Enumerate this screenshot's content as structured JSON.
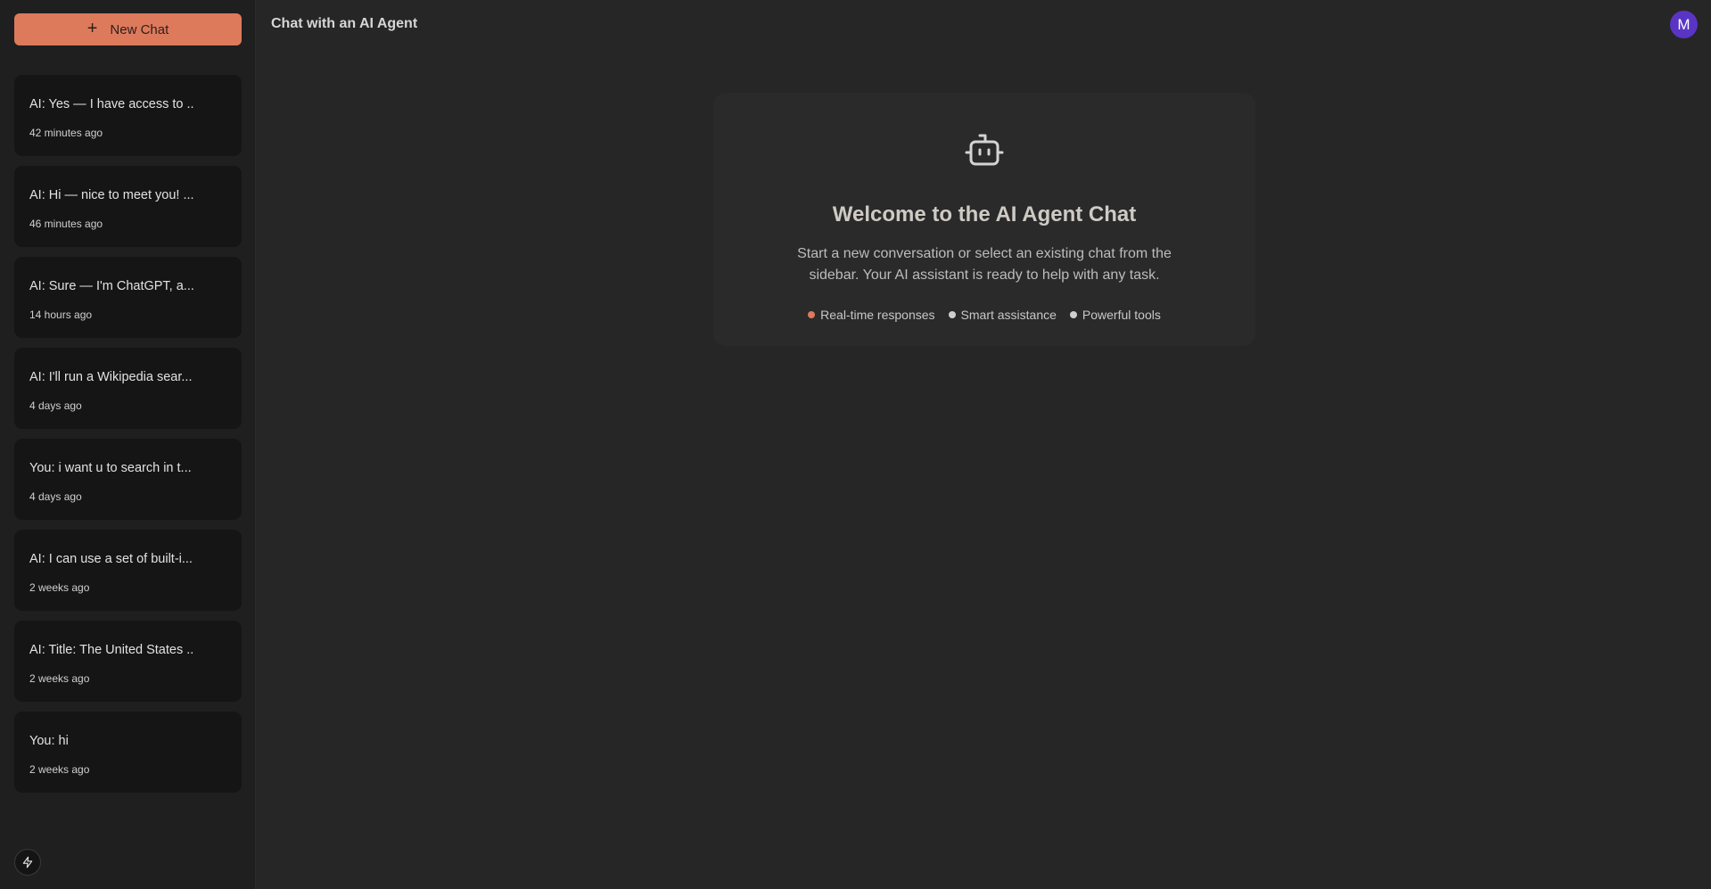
{
  "sidebar": {
    "new_chat_label": "New Chat",
    "chats": [
      {
        "title": "AI: Yes — I have access to ...",
        "time": "42 minutes ago"
      },
      {
        "title": "AI: Hi — nice to meet you! ...",
        "time": "46 minutes ago"
      },
      {
        "title": "AI: Sure — I'm ChatGPT, a...",
        "time": "14 hours ago"
      },
      {
        "title": "AI: I'll run a Wikipedia sear...",
        "time": "4 days ago"
      },
      {
        "title": "You: i want u to search in t...",
        "time": "4 days ago"
      },
      {
        "title": "AI: I can use a set of built-i...",
        "time": "2 weeks ago"
      },
      {
        "title": "AI: Title: The United States ...",
        "time": "2 weeks ago"
      },
      {
        "title": "You: hi",
        "time": "2 weeks ago"
      }
    ],
    "footer_icon": "bolt-icon"
  },
  "header": {
    "title": "Chat with an AI Agent",
    "avatar_initial": "M"
  },
  "welcome": {
    "icon": "robot-icon",
    "title": "Welcome to the AI Agent Chat",
    "description": "Start a new conversation or select an existing chat from the sidebar. Your AI assistant is ready to help with any task.",
    "features": [
      {
        "label": "Real-time responses",
        "color": "#e0785a"
      },
      {
        "label": "Smart assistance",
        "color": "#cfcfcf"
      },
      {
        "label": "Powerful tools",
        "color": "#cfcfcf"
      }
    ]
  },
  "colors": {
    "accent": "#de7a5c",
    "avatar": "#5a34c4",
    "background": "#262626",
    "sidebar": "#1f1f1f"
  }
}
